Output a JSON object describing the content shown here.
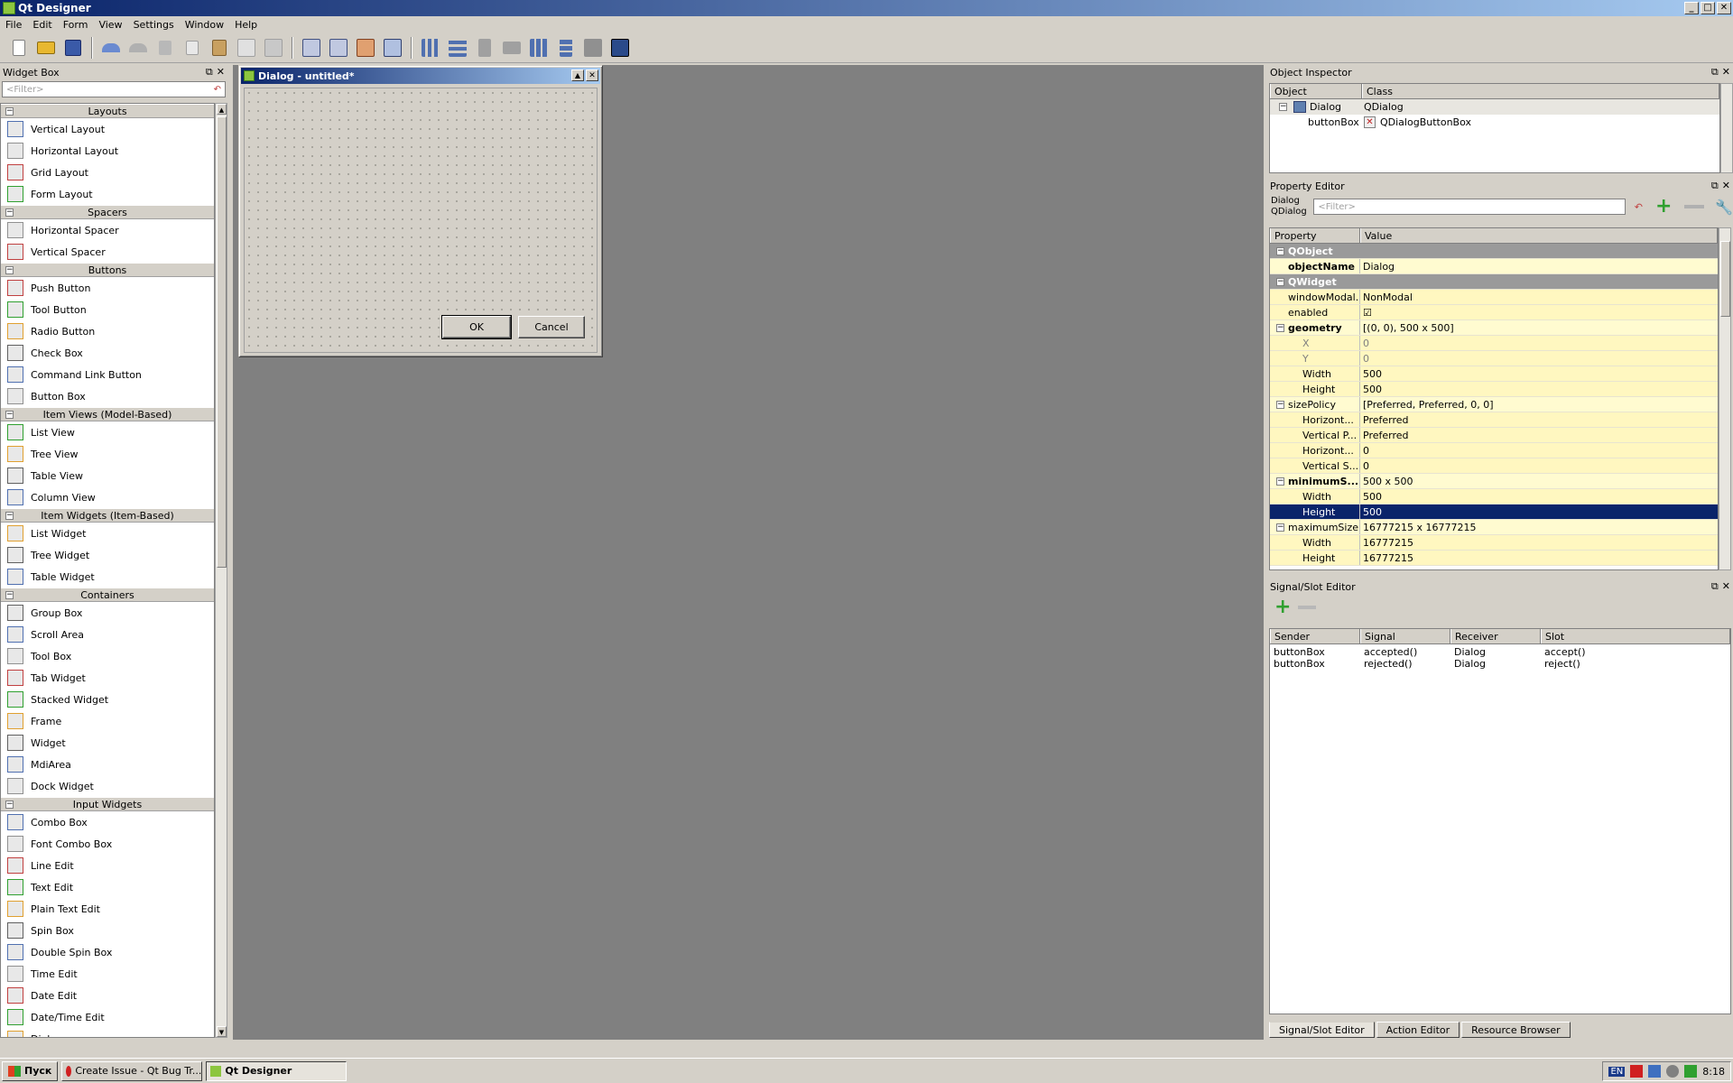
{
  "window": {
    "title": "Qt Designer",
    "min": "_",
    "max": "□",
    "close": "✕"
  },
  "menu": [
    "File",
    "Edit",
    "Form",
    "View",
    "Settings",
    "Window",
    "Help"
  ],
  "widget_box": {
    "title": "Widget Box",
    "filter_placeholder": "<Filter>",
    "categories": [
      {
        "name": "Layouts",
        "items": [
          "Vertical Layout",
          "Horizontal Layout",
          "Grid Layout",
          "Form Layout"
        ]
      },
      {
        "name": "Spacers",
        "items": [
          "Horizontal Spacer",
          "Vertical Spacer"
        ]
      },
      {
        "name": "Buttons",
        "items": [
          "Push Button",
          "Tool Button",
          "Radio Button",
          "Check Box",
          "Command Link Button",
          "Button Box"
        ]
      },
      {
        "name": "Item Views (Model-Based)",
        "items": [
          "List View",
          "Tree View",
          "Table View",
          "Column View"
        ]
      },
      {
        "name": "Item Widgets (Item-Based)",
        "items": [
          "List Widget",
          "Tree Widget",
          "Table Widget"
        ]
      },
      {
        "name": "Containers",
        "items": [
          "Group Box",
          "Scroll Area",
          "Tool Box",
          "Tab Widget",
          "Stacked Widget",
          "Frame",
          "Widget",
          "MdiArea",
          "Dock Widget"
        ]
      },
      {
        "name": "Input Widgets",
        "items": [
          "Combo Box",
          "Font Combo Box",
          "Line Edit",
          "Text Edit",
          "Plain Text Edit",
          "Spin Box",
          "Double Spin Box",
          "Time Edit",
          "Date Edit",
          "Date/Time Edit",
          "Dial"
        ]
      }
    ]
  },
  "dialog": {
    "title": "Dialog - untitled*",
    "ok": "OK",
    "cancel": "Cancel"
  },
  "object_inspector": {
    "title": "Object Inspector",
    "col_object": "Object",
    "col_class": "Class",
    "rows": [
      {
        "object": "Dialog",
        "class": "QDialog"
      },
      {
        "object": "buttonBox",
        "class": "QDialogButtonBox"
      }
    ]
  },
  "property_editor": {
    "title": "Property Editor",
    "object": "Dialog",
    "class": "QDialog",
    "filter_placeholder": "<Filter>",
    "col_property": "Property",
    "col_value": "Value",
    "rows": [
      {
        "name": "QObject",
        "value": "",
        "kind": "group"
      },
      {
        "name": "objectName",
        "value": "Dialog",
        "kind": "bold"
      },
      {
        "name": "QWidget",
        "value": "",
        "kind": "group"
      },
      {
        "name": "windowModal...",
        "value": "NonModal",
        "kind": "y"
      },
      {
        "name": "enabled",
        "value": "☑",
        "kind": "y"
      },
      {
        "name": "geometry",
        "value": "[(0, 0), 500 x 500]",
        "kind": "boldexp"
      },
      {
        "name": "X",
        "value": "0",
        "kind": "sub-grey"
      },
      {
        "name": "Y",
        "value": "0",
        "kind": "sub-grey"
      },
      {
        "name": "Width",
        "value": "500",
        "kind": "sub"
      },
      {
        "name": "Height",
        "value": "500",
        "kind": "sub"
      },
      {
        "name": "sizePolicy",
        "value": "[Preferred, Preferred, 0, 0]",
        "kind": "exp"
      },
      {
        "name": "Horizont...",
        "value": "Preferred",
        "kind": "sub"
      },
      {
        "name": "Vertical P...",
        "value": "Preferred",
        "kind": "sub"
      },
      {
        "name": "Horizont...",
        "value": "0",
        "kind": "sub"
      },
      {
        "name": "Vertical S...",
        "value": "0",
        "kind": "sub"
      },
      {
        "name": "minimumS...",
        "value": "500 x 500",
        "kind": "boldexp"
      },
      {
        "name": "Width",
        "value": "500",
        "kind": "sub"
      },
      {
        "name": "Height",
        "value": "500",
        "kind": "sel"
      },
      {
        "name": "maximumSize",
        "value": "16777215 x 16777215",
        "kind": "exp"
      },
      {
        "name": "Width",
        "value": "16777215",
        "kind": "sub"
      },
      {
        "name": "Height",
        "value": "16777215",
        "kind": "sub"
      }
    ]
  },
  "signal_slot_editor": {
    "title": "Signal/Slot Editor",
    "cols": [
      "Sender",
      "Signal",
      "Receiver",
      "Slot"
    ],
    "rows": [
      [
        "buttonBox",
        "accepted()",
        "Dialog",
        "accept()"
      ],
      [
        "buttonBox",
        "rejected()",
        "Dialog",
        "reject()"
      ]
    ],
    "tabs": [
      "Signal/Slot Editor",
      "Action Editor",
      "Resource Browser"
    ]
  },
  "taskbar": {
    "start": "Пуск",
    "tasks": [
      "Create Issue - Qt Bug Tr...",
      "Qt Designer"
    ],
    "lang": "EN",
    "time": "8:18"
  }
}
